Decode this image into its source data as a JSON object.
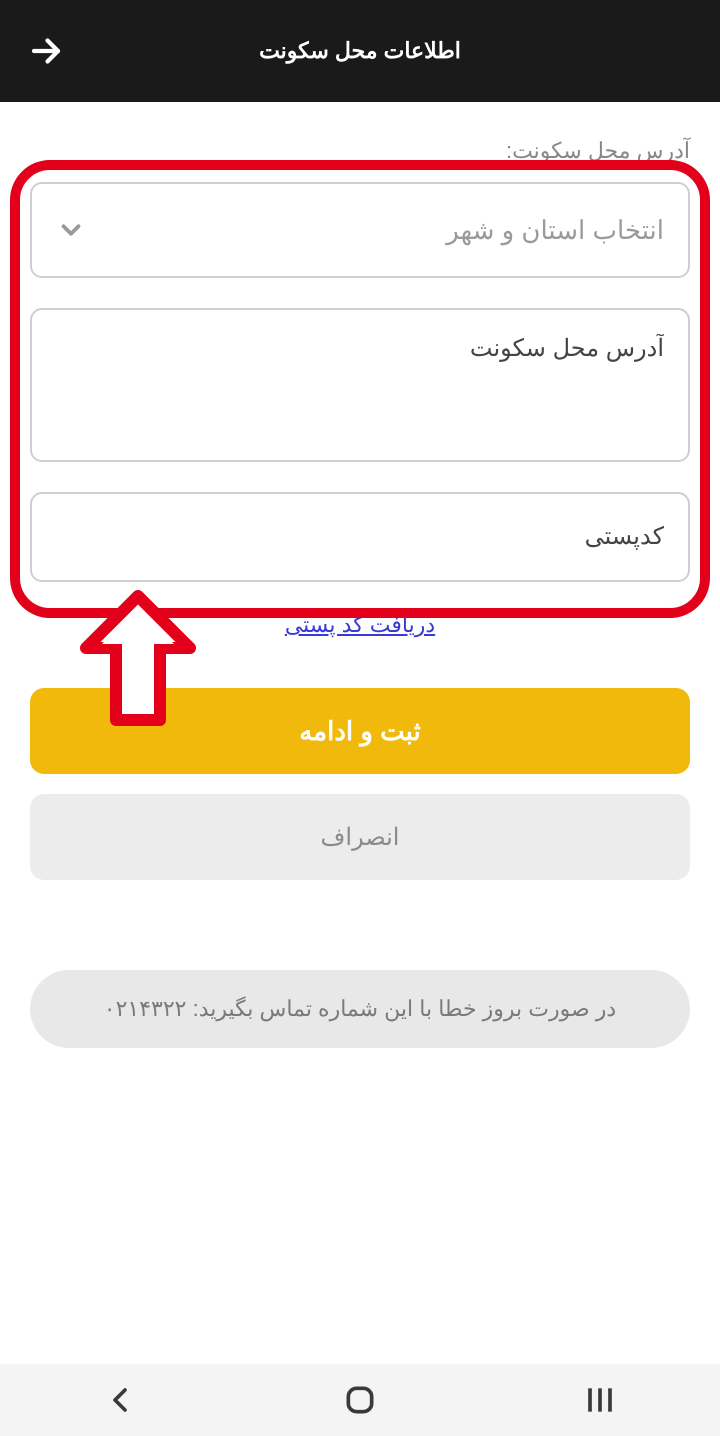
{
  "header": {
    "title": "اطلاعات محل سکونت"
  },
  "section_label": "آدرس محل سکونت:",
  "fields": {
    "province_city": {
      "placeholder": "انتخاب استان و شهر"
    },
    "address": {
      "placeholder": "آدرس محل سکونت",
      "value": ""
    },
    "postal": {
      "placeholder": "کدپستی",
      "value": ""
    }
  },
  "link": {
    "postal_code": "دریافت کد پستی"
  },
  "buttons": {
    "submit": "ثبت و ادامه",
    "cancel": "انصراف"
  },
  "help_text": "در صورت بروز خطا با این شماره تماس بگیرید: ۰۲۱۴۳۲۲",
  "colors": {
    "accent": "#f0b90b",
    "annotation": "#e3001b"
  }
}
